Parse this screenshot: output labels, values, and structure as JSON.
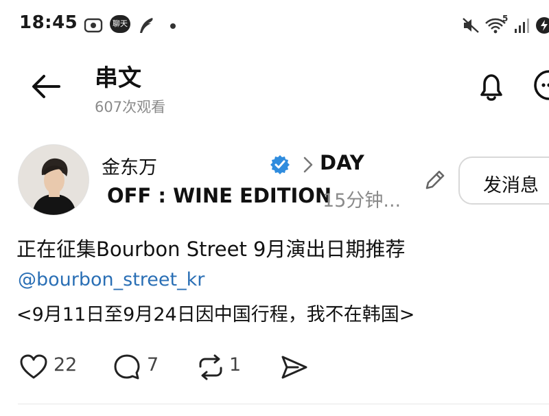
{
  "status_bar": {
    "time": "18:45",
    "chat_badge": "聊天",
    "icons": [
      "screen-record-icon",
      "chat-icon",
      "feather-icon",
      "dot-icon",
      "mute-icon",
      "wifi-icon",
      "signal-icon",
      "battery-icon"
    ],
    "wifi_label": "5"
  },
  "header": {
    "title": "串文",
    "views": "607次观看",
    "icons": [
      "back-arrow-icon",
      "bell-icon",
      "more-icon"
    ]
  },
  "post": {
    "author": "金东万",
    "verified": true,
    "channel_line1": "DAY",
    "channel_line2": "OFF : WINE EDITION",
    "time_ago": "15分钟...",
    "message_button": "发消息",
    "body_line1": "正在征集Bourbon Street 9月演出日期推荐",
    "mention": "@bourbon_street_kr",
    "body_line3": "<9月11日至9月24日因中国行程，我不在韩国>"
  },
  "actions": {
    "likes": "22",
    "comments": "7",
    "reposts": "1"
  },
  "colors": {
    "verified_blue": "#2f8cde",
    "mention_blue": "#2a6fb5",
    "muted_gray": "#8a8a8a"
  }
}
